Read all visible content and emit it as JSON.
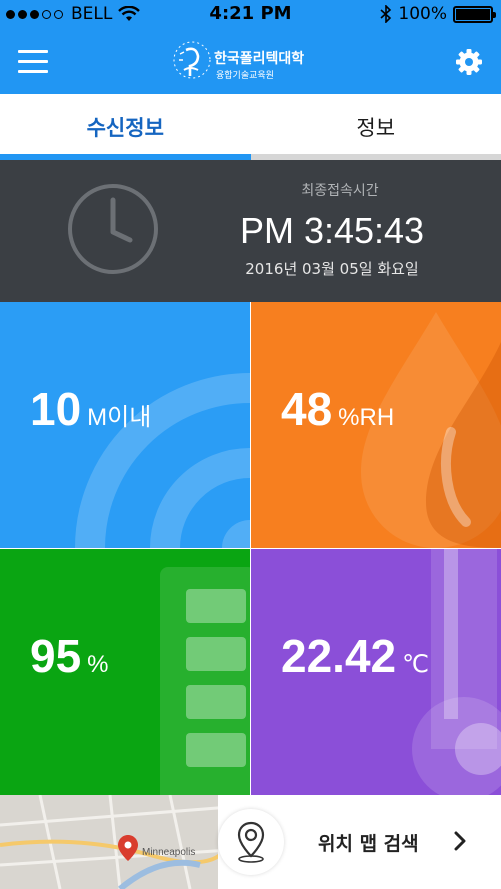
{
  "status_bar": {
    "carrier": "BELL",
    "time": "4:21 PM",
    "battery": "100%"
  },
  "header": {
    "logo_title": "한국폴리텍대학",
    "logo_subtitle": "융합기술교육원"
  },
  "tabs": [
    {
      "label": "수신정보",
      "active": true
    },
    {
      "label": "정보",
      "active": false
    }
  ],
  "last_access": {
    "label": "최종접속시간",
    "time": "PM 3:45:43",
    "date": "2016년 03월 05일 화요일"
  },
  "tiles": {
    "distance": {
      "value": "10",
      "unit": "M이내",
      "color": "#2b9df5"
    },
    "humidity": {
      "value": "48",
      "unit": "%RH",
      "color": "#f77f1f"
    },
    "battery": {
      "value": "95",
      "unit": "%",
      "color": "#0aa512"
    },
    "temperature": {
      "value": "22.42",
      "unit": "℃",
      "color": "#8b4fd8"
    }
  },
  "map": {
    "search_label": "위치 맵 검색",
    "place_label": "Minneapolis"
  },
  "colors": {
    "primary": "#2196f3",
    "dark_panel": "#3b3f44"
  }
}
